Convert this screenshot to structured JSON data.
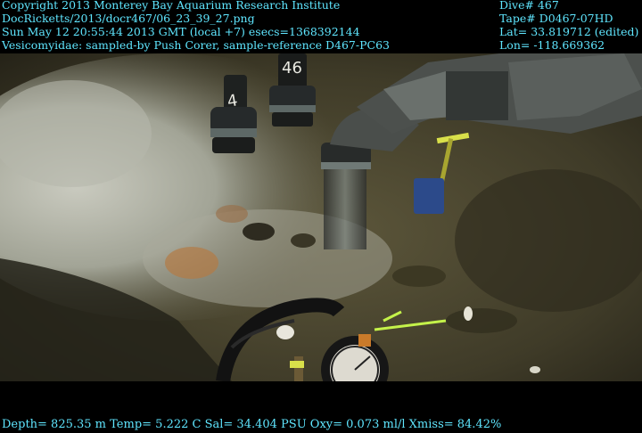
{
  "header_left": {
    "copyright": "Copyright 2013 Monterey Bay Aquarium Research Institute",
    "file": "DocRicketts/2013/docr467/06_23_39_27.png",
    "datetime": "Sun May 12 20:55:44 2013 GMT (local +7)  esecs=1368392144",
    "annotation": "Vesicomyidae: sampled-by Push Corer, sample-reference D467-PC63"
  },
  "header_right": {
    "dive": "Dive# 467",
    "tape": "Tape# D0467-07HD",
    "lat": "Lat= 33.819712 (edited)",
    "lon": "Lon= -118.669362"
  },
  "footer": {
    "telemetry": "Depth= 825.35 m  Temp= 5.222 C  Sal= 34.404 PSU  Oxy= 0.073 ml/l  Xmiss= 84.42%"
  },
  "scene": {
    "core_labels": [
      "4",
      "46"
    ]
  },
  "colors": {
    "overlay_text": "#5fe6ff",
    "seafloor": "#4a4530",
    "bacterial_mat": "#b8b9ad",
    "marker_yellow": "#d9e04a"
  }
}
